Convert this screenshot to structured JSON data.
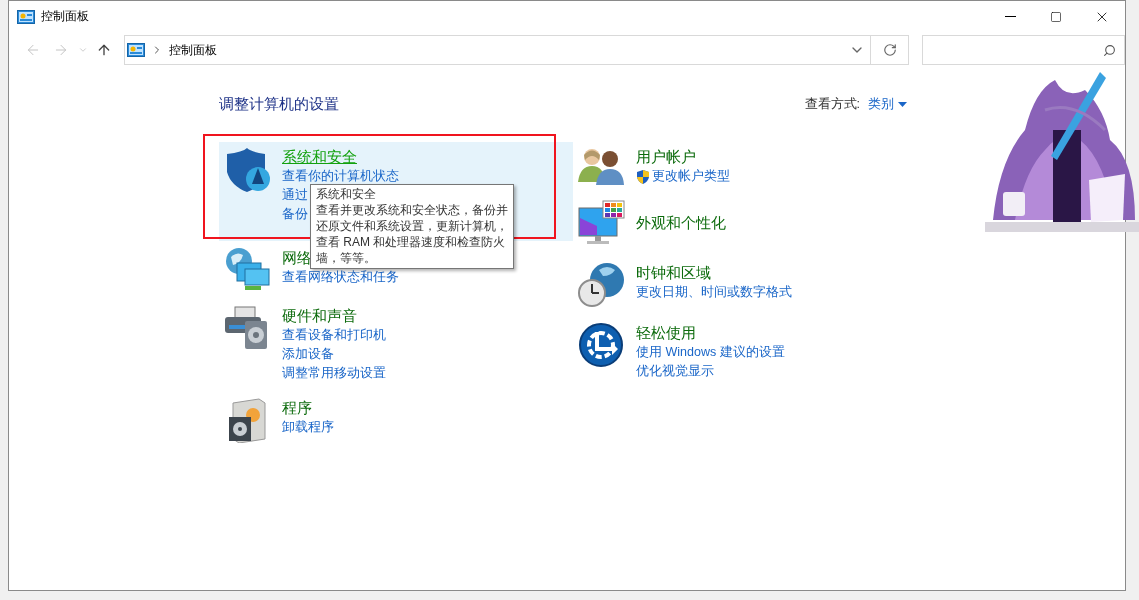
{
  "window": {
    "title": "控制面板"
  },
  "nav": {
    "back_disabled": true,
    "forward_disabled": true
  },
  "address_bar": {
    "path": [
      "控制面板"
    ]
  },
  "heading": "调整计算机的设置",
  "view_by": {
    "label": "查看方式:",
    "value": "类别"
  },
  "left_categories": [
    {
      "kind": "security",
      "title": "系统和安全",
      "hovered": true,
      "highlighted": true,
      "links": [
        {
          "text": "查看你的计算机状态",
          "shielded": false
        },
        {
          "text": "通过",
          "shielded": false
        },
        {
          "text": "备份",
          "shielded": false
        }
      ]
    },
    {
      "kind": "network",
      "title": "网络",
      "hovered": false,
      "highlighted": false,
      "links": [
        {
          "text": "查看网络状态和任务",
          "shielded": false
        }
      ]
    },
    {
      "kind": "hardware",
      "title": "硬件和声音",
      "hovered": false,
      "highlighted": false,
      "links": [
        {
          "text": "查看设备和打印机",
          "shielded": false
        },
        {
          "text": "添加设备",
          "shielded": false
        },
        {
          "text": "调整常用移动设置",
          "shielded": false
        }
      ]
    },
    {
      "kind": "programs",
      "title": "程序",
      "hovered": false,
      "highlighted": false,
      "links": [
        {
          "text": "卸载程序",
          "shielded": false
        }
      ]
    }
  ],
  "right_categories": [
    {
      "kind": "accounts",
      "title": "用户帐户",
      "hovered": false,
      "highlighted": false,
      "links": [
        {
          "text": "更改帐户类型",
          "shielded": true
        }
      ]
    },
    {
      "kind": "appearance",
      "title": "外观和个性化",
      "hovered": false,
      "highlighted": false
    },
    {
      "kind": "clock",
      "title": "时钟和区域",
      "hovered": false,
      "highlighted": false,
      "links": [
        {
          "text": "更改日期、时间或数字格式",
          "shielded": false
        }
      ]
    },
    {
      "kind": "ease",
      "title": "轻松使用",
      "hovered": false,
      "highlighted": false,
      "links": [
        {
          "text": "使用 Windows 建议的设置",
          "shielded": false
        },
        {
          "text": "优化视觉显示",
          "shielded": false
        }
      ]
    }
  ],
  "tooltip": {
    "title": "系统和安全",
    "text": "查看并更改系统和安全状态，备份并还原文件和系统设置，更新计算机，查看 RAM 和处理器速度和检查防火墙，等等。"
  }
}
